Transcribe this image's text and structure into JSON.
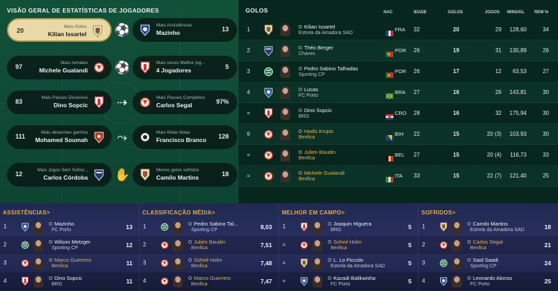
{
  "overview": {
    "title": "VISÃO GERAL DE ESTATÍSTICAS DE JOGADORES",
    "cards": [
      {
        "value": "20",
        "caption": "Mais Golos",
        "name": "Kilian Issartel",
        "club": "estrela",
        "icon": "kick-icon"
      },
      {
        "value": "13",
        "caption": "Mais Assistências",
        "name": "Mazinho",
        "club": "porto",
        "icon": ""
      },
      {
        "value": "97",
        "caption": "Mais remates",
        "name": "Michele Gualandi",
        "club": "benfica",
        "icon": "shot-icon"
      },
      {
        "value": "5",
        "caption": "Mais vezes Melhor jog...",
        "name": "4 Jogadores",
        "club": "braga",
        "icon": ""
      },
      {
        "value": "83",
        "caption": "Mais Passes Decisivos",
        "name": "Dino Sopcic",
        "club": "braga",
        "icon": "pass-icon"
      },
      {
        "value": "97%",
        "caption": "Mais Passes Completos",
        "name": "Carlos Segal",
        "club": "benfica",
        "icon": ""
      },
      {
        "value": "111",
        "caption": "Mais desarmes ganhos",
        "name": "Mohamed Soumah",
        "club": "gilvicente",
        "icon": "tackle-icon"
      },
      {
        "value": "128",
        "caption": "Mais fintas feitas",
        "name": "Francisco Branco",
        "club": "portimonense",
        "icon": ""
      },
      {
        "value": "12",
        "caption": "Mais Jogos Sem Sofrer...",
        "name": "Carlos Córdoba",
        "club": "chaves",
        "icon": "dive-icon"
      },
      {
        "value": "18",
        "caption": "Menos golos sofridos",
        "name": "Camilo Martins",
        "club": "estrela",
        "icon": ""
      }
    ]
  },
  "goals": {
    "title": "GOLOS",
    "columns": {
      "nat": "NAC",
      "age": "IDADE",
      "goals": "GOLOS",
      "apps": "JOGOS",
      "mpg": "MINS/GL",
      "rem": "REM %"
    },
    "rows": [
      {
        "pos": "1",
        "club": "estrela",
        "name": "Kilian Issartel",
        "team": "Estrela da Amadora SAD",
        "flag": "fra",
        "nat": "FRA",
        "age": "32",
        "goals": "20",
        "apps": "29",
        "mpg": "128,60",
        "rem": "34",
        "gold": false
      },
      {
        "pos": "2",
        "club": "chaves",
        "name": "Théo Berger",
        "team": "Chaves",
        "flag": "por",
        "nat": "POR",
        "age": "26",
        "goals": "19",
        "apps": "31",
        "mpg": "130,89",
        "rem": "26",
        "gold": false
      },
      {
        "pos": "3",
        "club": "sporting",
        "name": "Pedro Sabino Talhadas",
        "team": "Sporting CP",
        "flag": "por",
        "nat": "POR",
        "age": "26",
        "goals": "17",
        "apps": "12",
        "mpg": "63,53",
        "rem": "27",
        "gold": false
      },
      {
        "pos": "4",
        "club": "porto",
        "name": "Lucas",
        "team": "FC Porto",
        "flag": "bra",
        "nat": "BRA",
        "age": "27",
        "goals": "16",
        "apps": "26",
        "mpg": "143,81",
        "rem": "30",
        "gold": false
      },
      {
        "pos": "=",
        "club": "braga",
        "name": "Dino Sopcic",
        "team": "BRG",
        "flag": "cro",
        "nat": "CRO",
        "age": "28",
        "goals": "16",
        "apps": "32",
        "mpg": "175,94",
        "rem": "30",
        "gold": false
      },
      {
        "pos": "6",
        "club": "benfica",
        "name": "Hadis Krupic",
        "team": "Benfica",
        "flag": "bih",
        "nat": "BIH",
        "age": "22",
        "goals": "15",
        "apps": "20 (3)",
        "mpg": "103,93",
        "rem": "30",
        "gold": true
      },
      {
        "pos": "=",
        "club": "benfica",
        "name": "Julien Baudin",
        "team": "Benfica",
        "flag": "bel",
        "nat": "BEL",
        "age": "27",
        "goals": "15",
        "apps": "20 (4)",
        "mpg": "116,73",
        "rem": "33",
        "gold": true
      },
      {
        "pos": "=",
        "club": "benfica",
        "name": "Michele Gualandi",
        "team": "Benfica",
        "flag": "ita",
        "nat": "ITA",
        "age": "33",
        "goals": "15",
        "apps": "22 (7)",
        "mpg": "121,40",
        "rem": "25",
        "gold": true
      }
    ]
  },
  "bottom": [
    {
      "title": "ASSISTÊNCIAS",
      "arrow": ">",
      "rows": [
        {
          "pos": "1",
          "club": "porto",
          "name": "Mazinho",
          "team": "FC Porto",
          "value": "13",
          "gold": false
        },
        {
          "pos": "2",
          "club": "sporting",
          "name": "Wilson Metzger",
          "team": "Sporting CP",
          "value": "12",
          "gold": false
        },
        {
          "pos": "3",
          "club": "benfica",
          "name": "Marco Guerrero",
          "team": "Benfica",
          "value": "11",
          "gold": true
        },
        {
          "pos": "4",
          "club": "braga",
          "name": "Dino Sopcic",
          "team": "BRG",
          "value": "11",
          "gold": false
        }
      ]
    },
    {
      "title": "CLASSIFICAÇÃO MÉDIA",
      "arrow": ">",
      "rows": [
        {
          "pos": "1",
          "club": "sporting",
          "name": "Pedro Sabino Tal...",
          "team": "Sporting CP",
          "value": "8,03",
          "gold": false
        },
        {
          "pos": "2",
          "club": "benfica",
          "name": "Julien Baudin",
          "team": "Benfica",
          "value": "7,51",
          "gold": true
        },
        {
          "pos": "3",
          "club": "benfica",
          "name": "Soheil Holm",
          "team": "Benfica",
          "value": "7,48",
          "gold": true
        },
        {
          "pos": "4",
          "club": "benfica",
          "name": "Marco Guerrero",
          "team": "Benfica",
          "value": "7,47",
          "gold": true
        }
      ]
    },
    {
      "title": "MELHOR EM CAMPO",
      "arrow": ">",
      "rows": [
        {
          "pos": "1",
          "club": "braga",
          "name": "Joaquin Higuera",
          "team": "BRG",
          "value": "5",
          "gold": false
        },
        {
          "pos": "=",
          "club": "benfica",
          "name": "Soheil Holm",
          "team": "Benfica",
          "value": "5",
          "gold": true
        },
        {
          "pos": "=",
          "club": "estrela",
          "name": "L. Lo Piccolo",
          "team": "Estrela da Amadora SAD",
          "value": "5",
          "gold": false
        },
        {
          "pos": "=",
          "club": "porto",
          "name": "Kazadi Balikwisha",
          "team": "FC Porto",
          "value": "5",
          "gold": false
        }
      ]
    },
    {
      "title": "SOFRIDOS",
      "arrow": ">",
      "rows": [
        {
          "pos": "1",
          "club": "estrela",
          "name": "Camilo Martins",
          "team": "Estrela da Amadora SAD",
          "value": "18",
          "gold": false
        },
        {
          "pos": "2",
          "club": "benfica",
          "name": "Carlos Segal",
          "team": "Benfica",
          "value": "21",
          "gold": true
        },
        {
          "pos": "3",
          "club": "sporting",
          "name": "Said Saadi",
          "team": "Sporting CP",
          "value": "24",
          "gold": false
        },
        {
          "pos": "4",
          "club": "porto",
          "name": "Leonardo Alonso",
          "team": "FC Porto",
          "value": "25",
          "gold": false
        }
      ]
    }
  ]
}
